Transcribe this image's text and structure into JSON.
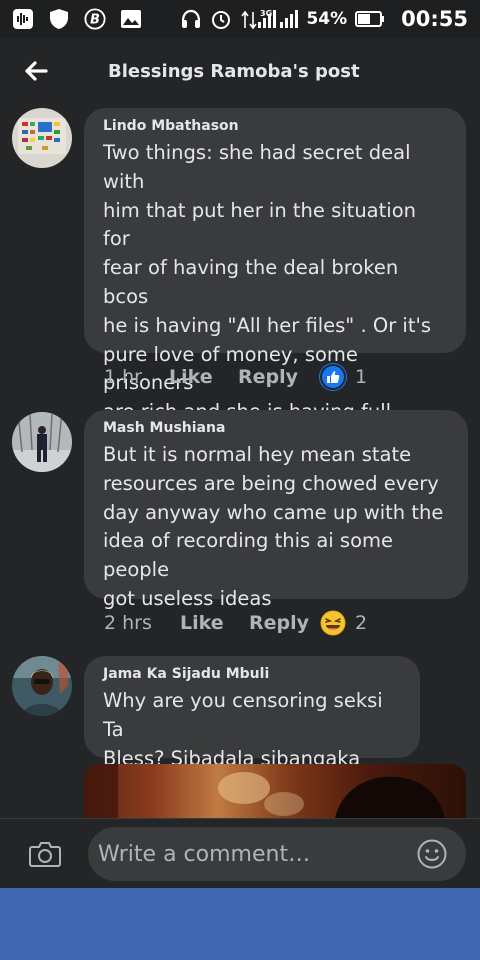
{
  "status_bar": {
    "battery_percent": "54%",
    "time": "00:55",
    "network_type": "3G",
    "icons": [
      "waveform-icon",
      "shield-icon",
      "b-badge-icon",
      "image-icon",
      "headphones-icon",
      "alarm-icon",
      "signal-icon",
      "battery-icon"
    ]
  },
  "header": {
    "title": "Blessings Ramoba's post",
    "back_icon": "back-arrow-icon"
  },
  "comments": [
    {
      "author": "Lindo Mbathason",
      "text": "Two things: she had secret deal with\nhim that put her in the situation for\nfear of having the deal broken bcos\nhe is having \"All her files\" . Or it's\npure love of money, some prisoners\nare rich and she is having full access\nto an ATM card.",
      "time": "1 hr",
      "like_label": "Like",
      "reply_label": "Reply",
      "reaction_icon": "thumbs-up-reaction-icon",
      "reaction_count": "1"
    },
    {
      "author": "Mash Mushiana",
      "text": "But it is normal hey mean state\nresources are being chowed every\nday anyway who came up with the\nidea of recording this ai some people\ngot useless ideas",
      "time": "2 hrs",
      "like_label": "Like",
      "reply_label": "Reply",
      "reaction_icon": "laughing-reaction-icon",
      "reaction_count": "2"
    },
    {
      "author": "Jama Ka Sijadu Mbuli",
      "text": "Why are you censoring seksi Ta\nBless? Sibadala sibangaka"
    }
  ],
  "composer": {
    "placeholder": "Write a comment…",
    "camera_icon": "camera-icon",
    "emoji_icon": "emoji-icon"
  },
  "colors": {
    "background": "#242526",
    "bubble": "#3a3b3c",
    "text": "#e4e6eb",
    "secondary_text": "#b0b3b8",
    "like_blue": "#1877f2",
    "nav_bar": "#4267b2"
  }
}
